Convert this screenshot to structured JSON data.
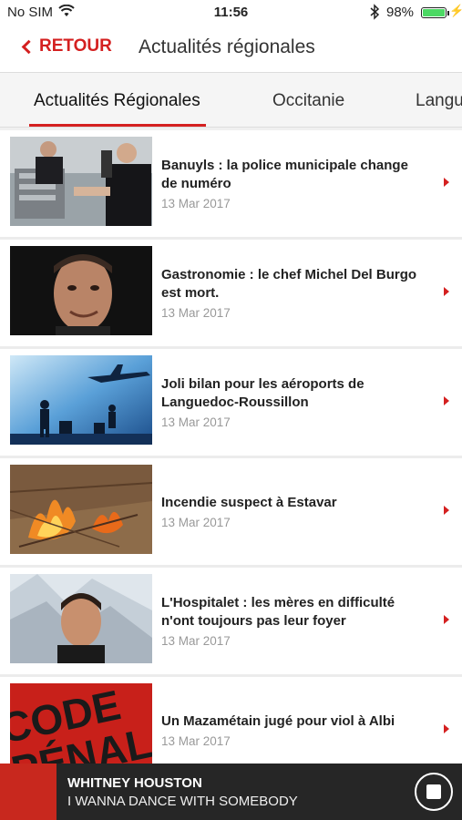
{
  "status_bar": {
    "carrier": "No SIM",
    "wifi_icon": "wifi-icon",
    "time": "11:56",
    "bluetooth_icon": "bluetooth-icon",
    "battery": "98%",
    "battery_level": 0.98,
    "charging_icon": "bolt-icon"
  },
  "nav": {
    "back_label": "RETOUR",
    "back_icon": "chevron-left-icon",
    "title": "Actualités régionales"
  },
  "tabs": [
    {
      "label": "Actualités Régionales",
      "active": true
    },
    {
      "label": "Occitanie",
      "active": false
    },
    {
      "label": "Langu",
      "active": false
    }
  ],
  "articles": [
    {
      "title": "Banuyls : la police municipale change de numéro",
      "date": "13 Mar 2017",
      "thumb": "office-photo"
    },
    {
      "title": "Gastronomie : le chef Michel Del Burgo est mort.",
      "date": "13 Mar 2017",
      "thumb": "portrait-photo"
    },
    {
      "title": "Joli bilan pour les aéroports de Languedoc-Roussillon",
      "date": "13 Mar 2017",
      "thumb": "airport-photo"
    },
    {
      "title": "Incendie suspect à Estavar",
      "date": "13 Mar 2017",
      "thumb": "fire-photo"
    },
    {
      "title": "L'Hospitalet : les mères en difficulté n'ont toujours pas leur foyer",
      "date": "13 Mar 2017",
      "thumb": "snow-portrait-photo"
    },
    {
      "title": "Un Mazamétain jugé pour viol à Albi",
      "date": "13 Mar 2017",
      "thumb": "code-penal-photo",
      "thumb_text": "CODE PÉNAL"
    }
  ],
  "player": {
    "artist": "WHITNEY HOUSTON",
    "track": "I WANNA DANCE WITH SOMEBODY",
    "stop_icon": "stop-icon"
  },
  "colors": {
    "accent": "#d42020",
    "player_bg": "#262626"
  }
}
